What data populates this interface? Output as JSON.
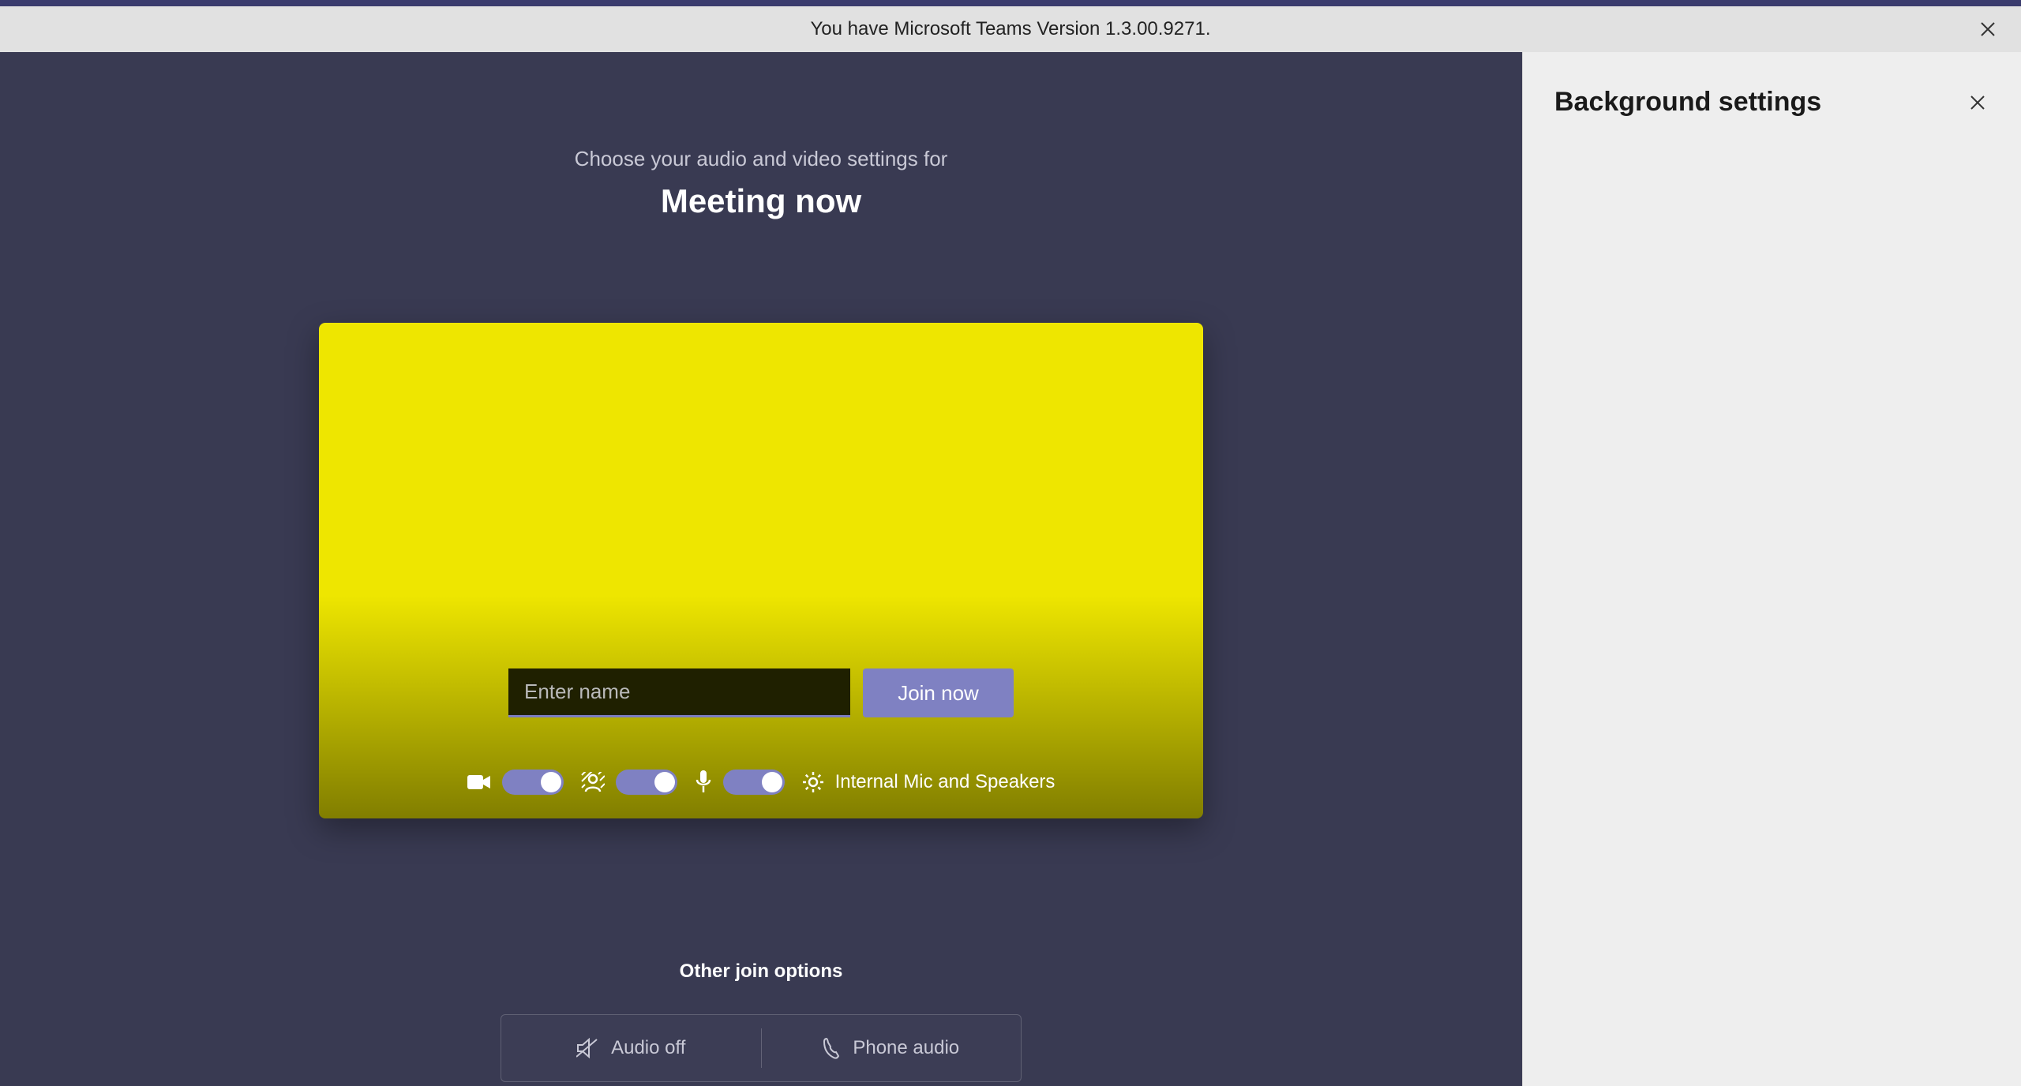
{
  "banner": {
    "text": "You have Microsoft Teams Version 1.3.00.9271."
  },
  "prejoin": {
    "lead": "Choose your audio and video settings for",
    "title": "Meeting now",
    "name_placeholder": "Enter name",
    "join_label": "Join now",
    "device_label": "Internal Mic and Speakers",
    "other_options_heading": "Other join options",
    "option_audio_off": "Audio off",
    "option_phone_audio": "Phone audio"
  },
  "side_panel": {
    "title": "Background settings"
  }
}
